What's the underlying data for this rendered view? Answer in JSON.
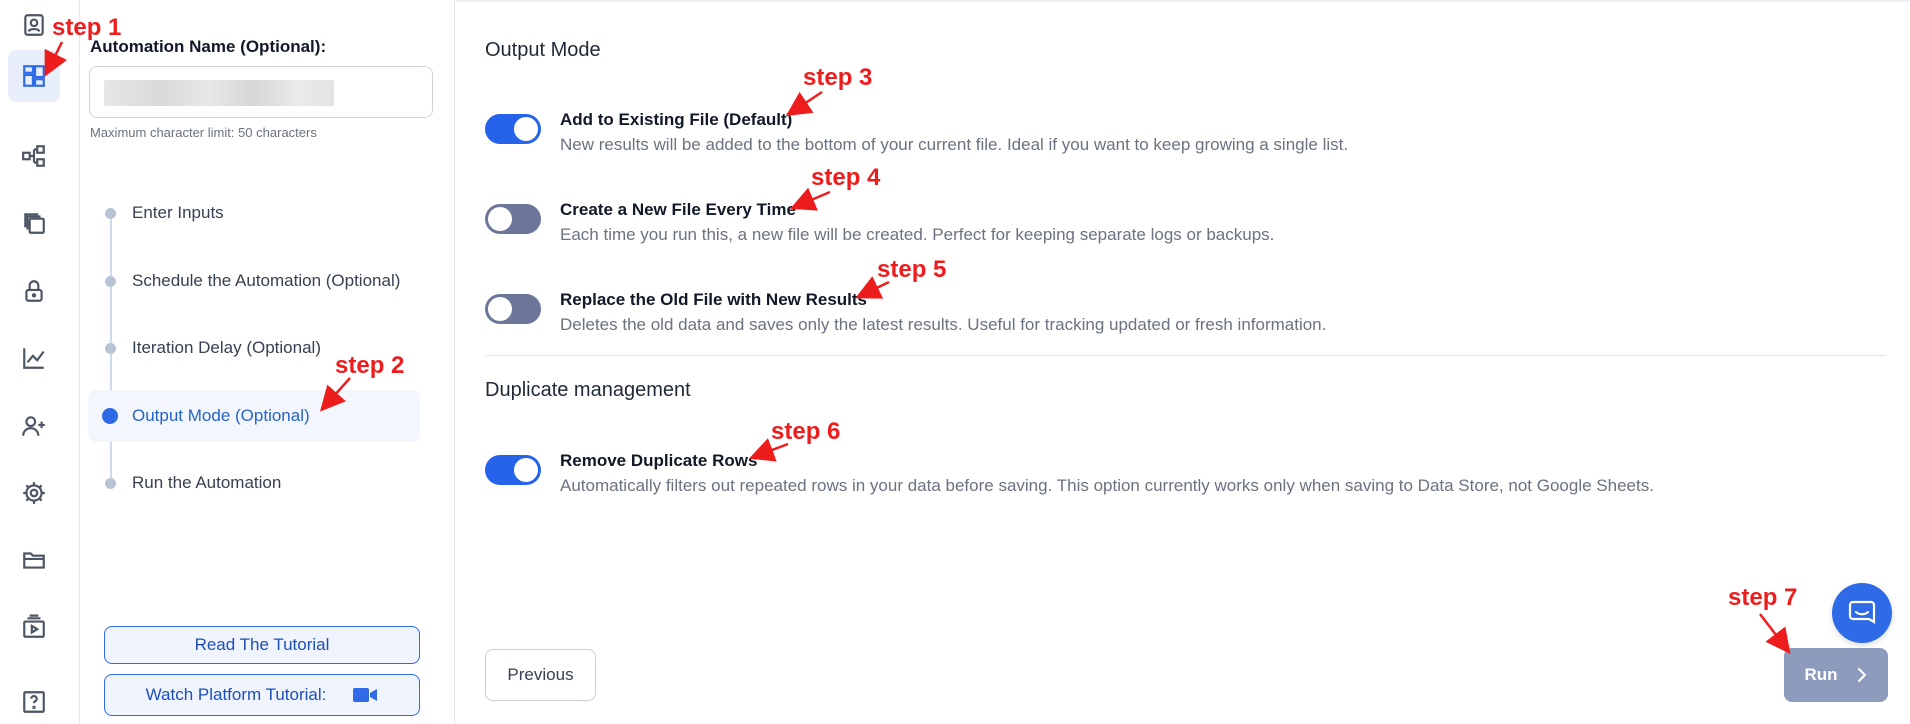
{
  "sidebar_icons": [
    {
      "name": "contact-icon",
      "active": false
    },
    {
      "name": "dashboard-icon",
      "active": true
    },
    {
      "name": "workflow-icon",
      "active": false
    },
    {
      "name": "copy-icon",
      "active": false
    },
    {
      "name": "lock-icon",
      "active": false
    },
    {
      "name": "analytics-icon",
      "active": false
    },
    {
      "name": "add-user-icon",
      "active": false
    },
    {
      "name": "gear-icon",
      "active": false
    },
    {
      "name": "folder-icon",
      "active": false
    },
    {
      "name": "video-library-icon",
      "active": false
    },
    {
      "name": "help-icon",
      "active": false
    }
  ],
  "panel": {
    "name_label": "Automation Name (Optional):",
    "name_value": "",
    "char_limit": "Maximum character limit: 50 characters",
    "steps": [
      {
        "label": "Enter Inputs",
        "active": false
      },
      {
        "label": "Schedule the Automation (Optional)",
        "active": false
      },
      {
        "label": "Iteration Delay (Optional)",
        "active": false
      },
      {
        "label": "Output Mode (Optional)",
        "active": true
      },
      {
        "label": "Run the Automation",
        "active": false
      }
    ],
    "read_tutorial": "Read The Tutorial",
    "watch_tutorial": "Watch Platform Tutorial:"
  },
  "output_mode": {
    "title": "Output Mode",
    "options": [
      {
        "title": "Add to Existing File (Default)",
        "desc": "New results will be added to the bottom of your current file. Ideal if you want to keep growing a single list.",
        "on": true
      },
      {
        "title": "Create a New File Every Time",
        "desc": "Each time you run this, a new file will be created. Perfect for keeping separate logs or backups.",
        "on": false
      },
      {
        "title": "Replace the Old File with New Results",
        "desc": "Deletes the old data and saves only the latest results. Useful for tracking updated or fresh information.",
        "on": false
      }
    ]
  },
  "duplicates": {
    "title": "Duplicate management",
    "option": {
      "title": "Remove Duplicate Rows",
      "desc": "Automatically filters out repeated rows in your data before saving. This option currently works only when saving to Data Store, not Google Sheets.",
      "on": true
    }
  },
  "footer": {
    "previous": "Previous",
    "run": "Run"
  },
  "annotations": {
    "color": "#ee1d1d",
    "step1": "step 1",
    "step2": "step 2",
    "step3": "step 3",
    "step4": "step 4",
    "step5": "step 5",
    "step6": "step 6",
    "step7": "step 7"
  }
}
